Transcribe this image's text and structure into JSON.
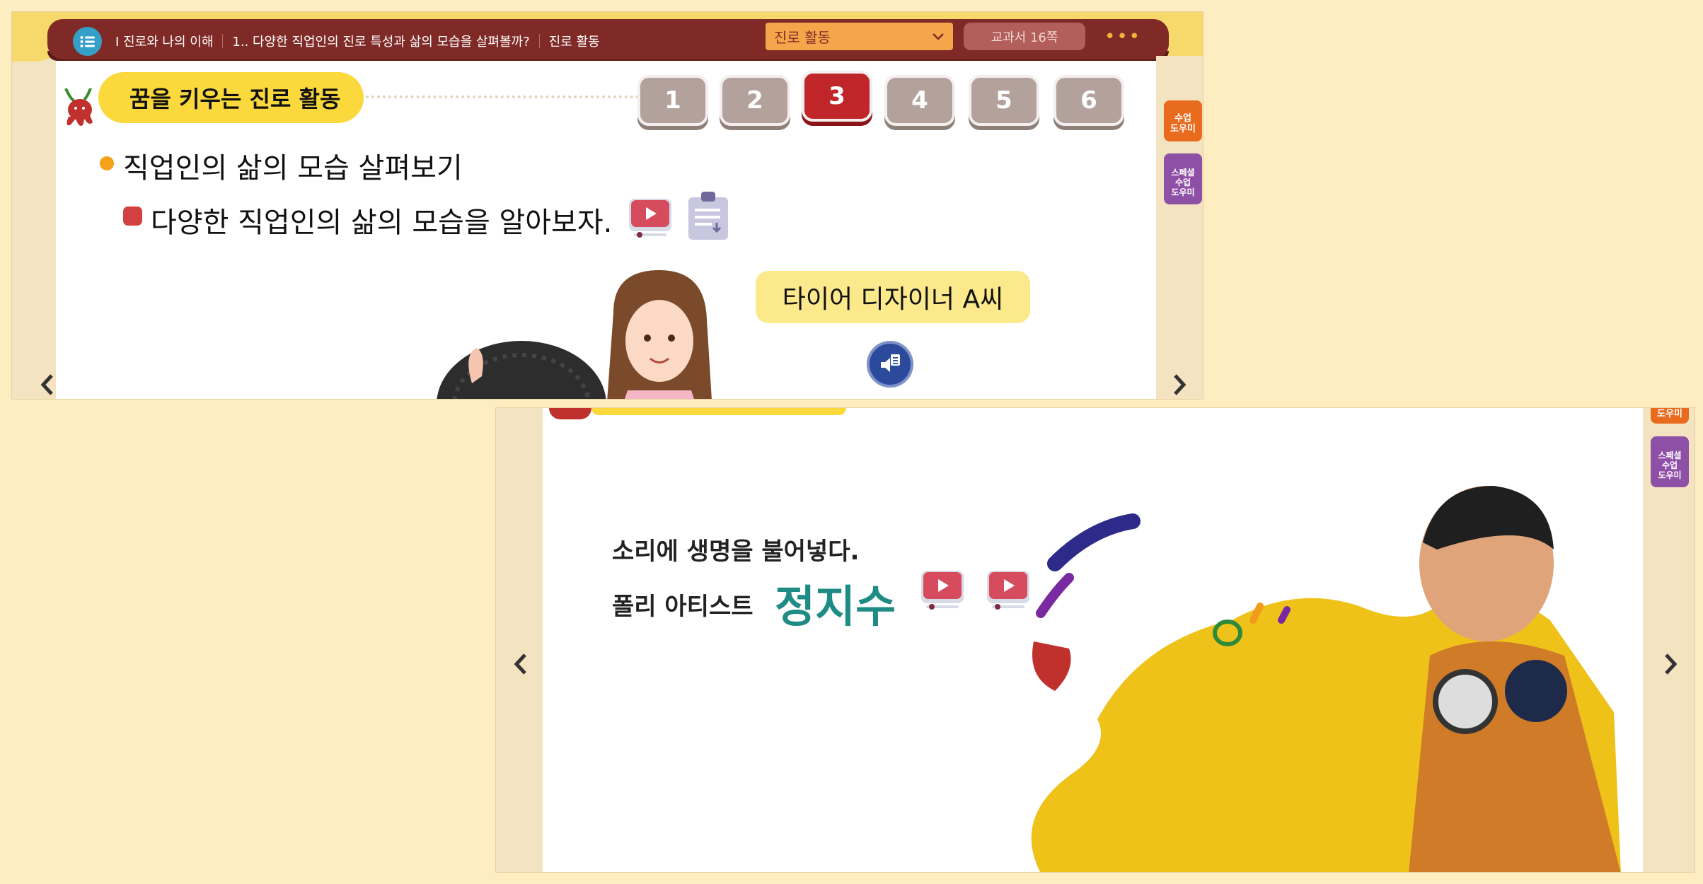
{
  "header": {
    "breadcrumb": [
      "Ⅰ 진로와 나의 이해",
      "1.. 다양한 직업인의 진로 특성과 삶의 모습을 살펴볼까?",
      "진로 활동"
    ],
    "select_value": "진로 활동",
    "textbook_page": "교과서 16쪽",
    "more": "•••"
  },
  "activity": {
    "title": "꿈을 키우는 진로 활동",
    "steps": [
      "1",
      "2",
      "3",
      "4",
      "5",
      "6"
    ],
    "active_step": 3
  },
  "content": {
    "section_title": "직업인의 삶의 모습 살펴보기",
    "subtitle": "다양한 직업인의 삶의 모습을 알아보자.",
    "speech": "타이어 디자이너 A씨"
  },
  "side_tools": {
    "class_helper": "수업\n도우미",
    "special_helper": "스페셜\n수업\n도우미",
    "class_helper_short": "도우미"
  },
  "panel2": {
    "line1": "소리에 생명을 불어넣다.",
    "line2_prefix": "폴리 아티스트",
    "name": "정지수"
  },
  "icons": {
    "menu": "list-icon",
    "dropdown": "chevron-down-icon",
    "prev": "chevron-left-icon",
    "next": "chevron-right-icon",
    "video": "video-play-icon",
    "clipboard": "clipboard-download-icon",
    "audio": "speaker-icon"
  },
  "colors": {
    "topbar": "#7f2a26",
    "accent_yellow": "#fbd93c",
    "active_step": "#c0252a",
    "inactive_step": "#b3a19b",
    "name_teal": "#1e8c85",
    "page_bg": "#fdedc0"
  }
}
